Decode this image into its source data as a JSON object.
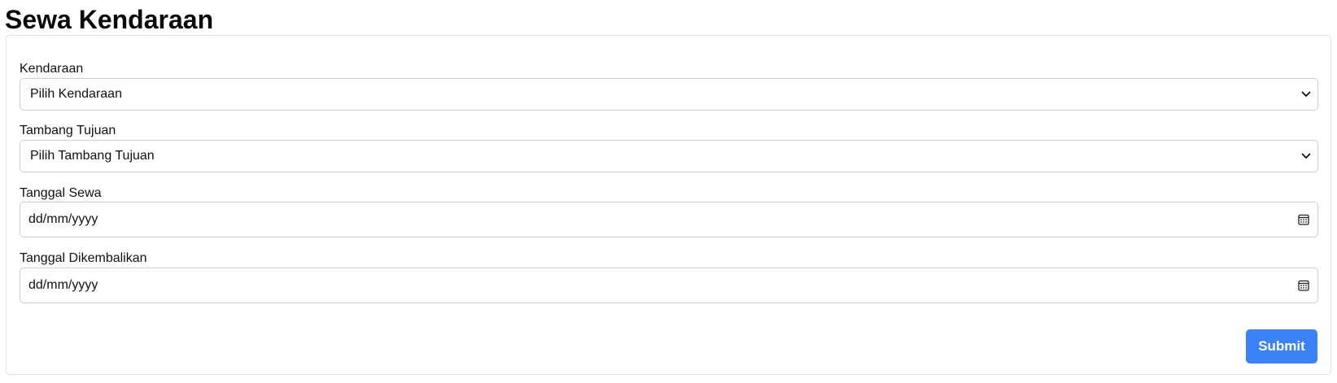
{
  "page": {
    "title": "Sewa Kendaraan"
  },
  "form": {
    "vehicle": {
      "label": "Kendaraan",
      "selected": "Pilih Kendaraan"
    },
    "destination_mine": {
      "label": "Tambang Tujuan",
      "selected": "Pilih Tambang Tujuan"
    },
    "rental_date": {
      "label": "Tanggal Sewa",
      "placeholder": "dd/mm/yyyy"
    },
    "return_date": {
      "label": "Tanggal Dikembalikan",
      "placeholder": "dd/mm/yyyy"
    },
    "submit_label": "Submit"
  },
  "icons": {
    "select_arrow": "chevron-down-icon",
    "date_picker": "calendar-icon"
  },
  "colors": {
    "submit_button": "#3b82f6",
    "control_border": "#cfcfcf",
    "card_border": "#e3e3e3"
  }
}
